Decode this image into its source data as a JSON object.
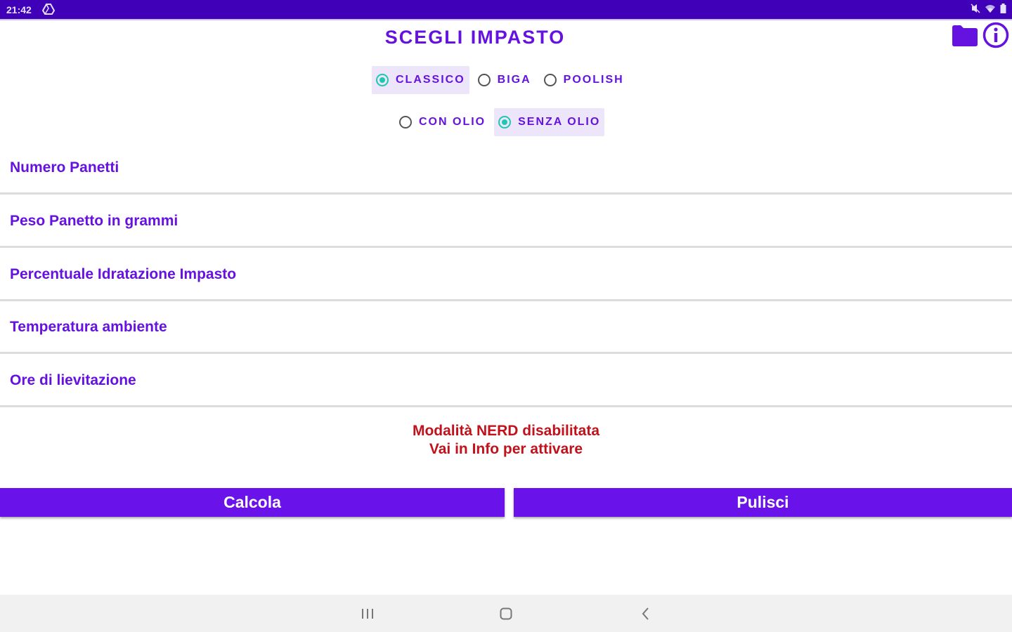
{
  "status_bar": {
    "time": "21:42",
    "left_icons": [
      "drive-icon"
    ],
    "right_icons": [
      "mute-icon",
      "wifi-icon",
      "battery-icon"
    ]
  },
  "header": {
    "title": "SCEGLI IMPASTO",
    "icons": [
      "folder-icon",
      "info-icon"
    ]
  },
  "dough_type": {
    "options": [
      {
        "label": "CLASSICO",
        "checked": true
      },
      {
        "label": "BIGA",
        "checked": false
      },
      {
        "label": "POOLISH",
        "checked": false
      }
    ]
  },
  "oil": {
    "options": [
      {
        "label": "CON OLIO",
        "checked": false
      },
      {
        "label": "SENZA OLIO",
        "checked": true
      }
    ]
  },
  "fields": {
    "numero_panetti": {
      "hint": "Numero Panetti",
      "value": ""
    },
    "peso_panetto": {
      "hint": "Peso Panetto in grammi",
      "value": ""
    },
    "idratazione": {
      "hint": "Percentuale Idratazione Impasto",
      "value": ""
    },
    "temperatura": {
      "hint": "Temperatura ambiente",
      "value": ""
    },
    "lievitazione": {
      "hint": "Ore di lievitazione",
      "value": ""
    }
  },
  "nerd_message": {
    "line1": "Modalità NERD disabilitata",
    "line2": "Vai in Info per attivare"
  },
  "buttons": {
    "calcola": "Calcola",
    "pulisci": "Pulisci"
  },
  "colors": {
    "primary": "#6a12ea",
    "status_bar": "#3f00b8",
    "accent": "#1ec8b0",
    "warning": "#c1121c"
  },
  "nav_bar": {
    "icons": [
      "recents-icon",
      "home-icon",
      "back-icon"
    ]
  }
}
